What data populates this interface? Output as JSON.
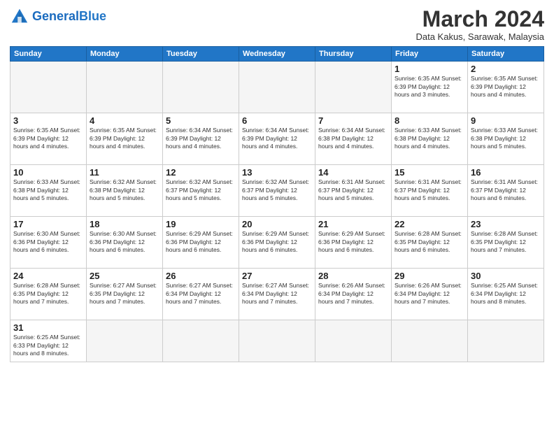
{
  "header": {
    "logo_general": "General",
    "logo_blue": "Blue",
    "month_title": "March 2024",
    "subtitle": "Data Kakus, Sarawak, Malaysia"
  },
  "weekdays": [
    "Sunday",
    "Monday",
    "Tuesday",
    "Wednesday",
    "Thursday",
    "Friday",
    "Saturday"
  ],
  "weeks": [
    [
      {
        "day": "",
        "info": ""
      },
      {
        "day": "",
        "info": ""
      },
      {
        "day": "",
        "info": ""
      },
      {
        "day": "",
        "info": ""
      },
      {
        "day": "",
        "info": ""
      },
      {
        "day": "1",
        "info": "Sunrise: 6:35 AM\nSunset: 6:39 PM\nDaylight: 12 hours\nand 3 minutes."
      },
      {
        "day": "2",
        "info": "Sunrise: 6:35 AM\nSunset: 6:39 PM\nDaylight: 12 hours\nand 4 minutes."
      }
    ],
    [
      {
        "day": "3",
        "info": "Sunrise: 6:35 AM\nSunset: 6:39 PM\nDaylight: 12 hours\nand 4 minutes."
      },
      {
        "day": "4",
        "info": "Sunrise: 6:35 AM\nSunset: 6:39 PM\nDaylight: 12 hours\nand 4 minutes."
      },
      {
        "day": "5",
        "info": "Sunrise: 6:34 AM\nSunset: 6:39 PM\nDaylight: 12 hours\nand 4 minutes."
      },
      {
        "day": "6",
        "info": "Sunrise: 6:34 AM\nSunset: 6:39 PM\nDaylight: 12 hours\nand 4 minutes."
      },
      {
        "day": "7",
        "info": "Sunrise: 6:34 AM\nSunset: 6:38 PM\nDaylight: 12 hours\nand 4 minutes."
      },
      {
        "day": "8",
        "info": "Sunrise: 6:33 AM\nSunset: 6:38 PM\nDaylight: 12 hours\nand 4 minutes."
      },
      {
        "day": "9",
        "info": "Sunrise: 6:33 AM\nSunset: 6:38 PM\nDaylight: 12 hours\nand 5 minutes."
      }
    ],
    [
      {
        "day": "10",
        "info": "Sunrise: 6:33 AM\nSunset: 6:38 PM\nDaylight: 12 hours\nand 5 minutes."
      },
      {
        "day": "11",
        "info": "Sunrise: 6:32 AM\nSunset: 6:38 PM\nDaylight: 12 hours\nand 5 minutes."
      },
      {
        "day": "12",
        "info": "Sunrise: 6:32 AM\nSunset: 6:37 PM\nDaylight: 12 hours\nand 5 minutes."
      },
      {
        "day": "13",
        "info": "Sunrise: 6:32 AM\nSunset: 6:37 PM\nDaylight: 12 hours\nand 5 minutes."
      },
      {
        "day": "14",
        "info": "Sunrise: 6:31 AM\nSunset: 6:37 PM\nDaylight: 12 hours\nand 5 minutes."
      },
      {
        "day": "15",
        "info": "Sunrise: 6:31 AM\nSunset: 6:37 PM\nDaylight: 12 hours\nand 5 minutes."
      },
      {
        "day": "16",
        "info": "Sunrise: 6:31 AM\nSunset: 6:37 PM\nDaylight: 12 hours\nand 6 minutes."
      }
    ],
    [
      {
        "day": "17",
        "info": "Sunrise: 6:30 AM\nSunset: 6:36 PM\nDaylight: 12 hours\nand 6 minutes."
      },
      {
        "day": "18",
        "info": "Sunrise: 6:30 AM\nSunset: 6:36 PM\nDaylight: 12 hours\nand 6 minutes."
      },
      {
        "day": "19",
        "info": "Sunrise: 6:29 AM\nSunset: 6:36 PM\nDaylight: 12 hours\nand 6 minutes."
      },
      {
        "day": "20",
        "info": "Sunrise: 6:29 AM\nSunset: 6:36 PM\nDaylight: 12 hours\nand 6 minutes."
      },
      {
        "day": "21",
        "info": "Sunrise: 6:29 AM\nSunset: 6:36 PM\nDaylight: 12 hours\nand 6 minutes."
      },
      {
        "day": "22",
        "info": "Sunrise: 6:28 AM\nSunset: 6:35 PM\nDaylight: 12 hours\nand 6 minutes."
      },
      {
        "day": "23",
        "info": "Sunrise: 6:28 AM\nSunset: 6:35 PM\nDaylight: 12 hours\nand 7 minutes."
      }
    ],
    [
      {
        "day": "24",
        "info": "Sunrise: 6:28 AM\nSunset: 6:35 PM\nDaylight: 12 hours\nand 7 minutes."
      },
      {
        "day": "25",
        "info": "Sunrise: 6:27 AM\nSunset: 6:35 PM\nDaylight: 12 hours\nand 7 minutes."
      },
      {
        "day": "26",
        "info": "Sunrise: 6:27 AM\nSunset: 6:34 PM\nDaylight: 12 hours\nand 7 minutes."
      },
      {
        "day": "27",
        "info": "Sunrise: 6:27 AM\nSunset: 6:34 PM\nDaylight: 12 hours\nand 7 minutes."
      },
      {
        "day": "28",
        "info": "Sunrise: 6:26 AM\nSunset: 6:34 PM\nDaylight: 12 hours\nand 7 minutes."
      },
      {
        "day": "29",
        "info": "Sunrise: 6:26 AM\nSunset: 6:34 PM\nDaylight: 12 hours\nand 7 minutes."
      },
      {
        "day": "30",
        "info": "Sunrise: 6:25 AM\nSunset: 6:34 PM\nDaylight: 12 hours\nand 8 minutes."
      }
    ],
    [
      {
        "day": "31",
        "info": "Sunrise: 6:25 AM\nSunset: 6:33 PM\nDaylight: 12 hours\nand 8 minutes."
      },
      {
        "day": "",
        "info": ""
      },
      {
        "day": "",
        "info": ""
      },
      {
        "day": "",
        "info": ""
      },
      {
        "day": "",
        "info": ""
      },
      {
        "day": "",
        "info": ""
      },
      {
        "day": "",
        "info": ""
      }
    ]
  ]
}
